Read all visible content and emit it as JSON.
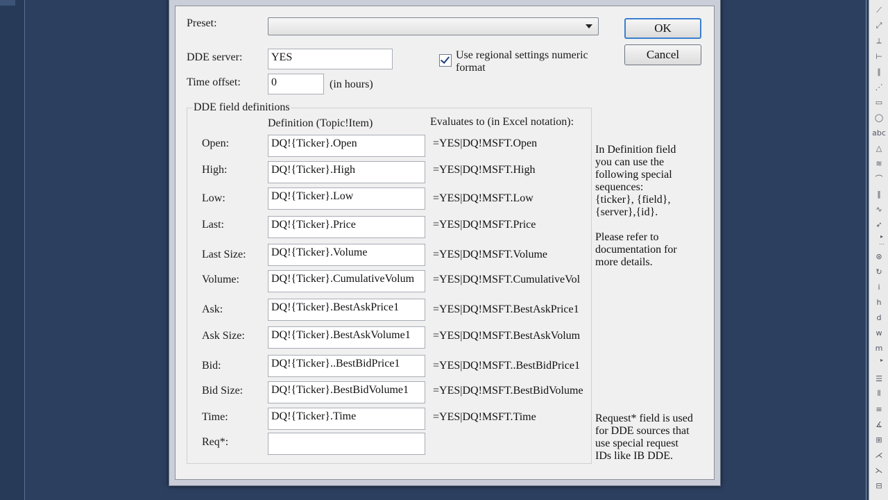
{
  "dialog": {
    "preset_label": "Preset:",
    "preset_value": "",
    "ok_label": "OK",
    "cancel_label": "Cancel",
    "dde_server_label": "DDE server:",
    "dde_server_value": "YES",
    "time_offset_label": "Time offset:",
    "time_offset_value": "0",
    "time_offset_unit": "(in hours)",
    "regional_settings_label": "Use regional settings numeric format",
    "regional_settings_checked": true,
    "group_title": "DDE field definitions",
    "col_definition": "Definition (Topic!Item)",
    "col_evaluates": "Evaluates to (in Excel notation):",
    "fields": [
      {
        "label": "Open:",
        "definition": "DQ!{Ticker}.Open",
        "evaluates": "=YES|DQ!MSFT.Open"
      },
      {
        "label": "High:",
        "definition": "DQ!{Ticker}.High",
        "evaluates": "=YES|DQ!MSFT.High"
      },
      {
        "label": "Low:",
        "definition": "DQ!{Ticker}.Low",
        "evaluates": "=YES|DQ!MSFT.Low"
      },
      {
        "label": "Last:",
        "definition": "DQ!{Ticker}.Price",
        "evaluates": "=YES|DQ!MSFT.Price"
      },
      {
        "label": "Last Size:",
        "definition": "DQ!{Ticker}.Volume",
        "evaluates": "=YES|DQ!MSFT.Volume"
      },
      {
        "label": "Volume:",
        "definition": "DQ!{Ticker}.CumulativeVolum",
        "evaluates": "=YES|DQ!MSFT.CumulativeVol"
      },
      {
        "label": "Ask:",
        "definition": "DQ!{Ticker}.BestAskPrice1",
        "evaluates": "=YES|DQ!MSFT.BestAskPrice1"
      },
      {
        "label": "Ask Size:",
        "definition": "DQ!{Ticker}.BestAskVolume1",
        "evaluates": "=YES|DQ!MSFT.BestAskVolum"
      },
      {
        "label": "Bid:",
        "definition": "DQ!{Ticker}..BestBidPrice1",
        "evaluates": "=YES|DQ!MSFT..BestBidPrice1"
      },
      {
        "label": "Bid Size:",
        "definition": "DQ!{Ticker}.BestBidVolume1",
        "evaluates": "=YES|DQ!MSFT.BestBidVolume"
      },
      {
        "label": "Time:",
        "definition": "DQ!{Ticker}.Time",
        "evaluates": "=YES|DQ!MSFT.Time"
      },
      {
        "label": "Req*:",
        "definition": "",
        "evaluates": ""
      }
    ],
    "note_definition": "In Definition field\nyou can use the\nfollowing special\nsequences:\n{ticker}, {field},\n{server},{id}.\n\nPlease refer to\ndocumentation for\nmore details.",
    "note_request": "Request* field is used\nfor DDE sources that\nuse special request\nIDs like IB DDE."
  },
  "toolbar": {
    "icons": [
      "line-icon",
      "ray-icon",
      "vertical-line-icon",
      "horizontal-line-icon",
      "parallel-lines-icon",
      "fan-icon",
      "rectangle-icon",
      "ellipse-icon",
      "text-icon",
      "triangle-icon",
      "zigzag-icon",
      "arc-icon",
      "cycle-lines-icon",
      "polyline-icon",
      "arrow-icon",
      "expand-icon",
      "more-icon",
      "fib-circle-icon",
      "fib-spiral-icon",
      "i-icon",
      "h-icon",
      "d-icon",
      "w-icon",
      "m-icon",
      "expand-icon",
      "fib-retrace-icon",
      "fib-time-icon",
      "fib-ext-icon",
      "gann-fan-icon",
      "gann-grid-icon",
      "andrews-icon",
      "speed-lines-icon",
      "regression-icon"
    ],
    "glyphs": [
      "⟋",
      "⤢",
      "⟂",
      "⊢",
      "∥",
      "⋰",
      "▭",
      "◯",
      "abc",
      "△",
      "≋",
      "⌒",
      "‖",
      "∿",
      "➶",
      "▸",
      "⋯",
      "⊛",
      "↻",
      "i",
      "h",
      "d",
      "w",
      "m",
      "▸",
      "☰",
      "⦀",
      "≡",
      "∡",
      "⊞",
      "⋌",
      "⋋",
      "⊟"
    ]
  }
}
